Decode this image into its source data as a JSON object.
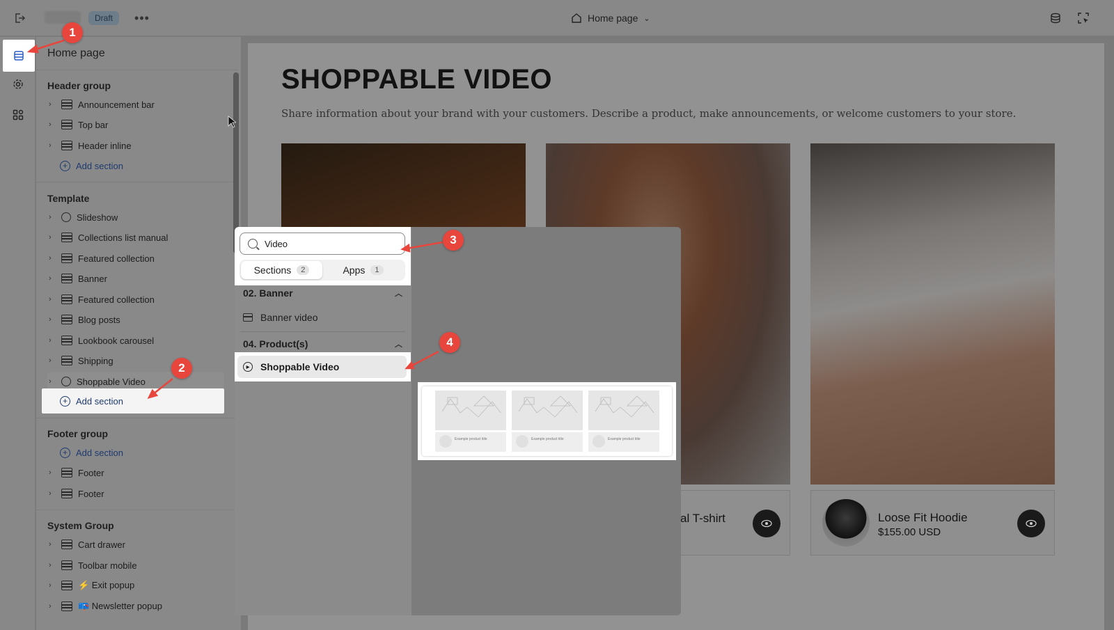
{
  "topbar": {
    "status_badge": "Draft",
    "page_selector": "Home page"
  },
  "sidebar": {
    "title": "Home page",
    "header_group": {
      "label": "Header group",
      "items": [
        "Announcement bar",
        "Top bar",
        "Header inline"
      ],
      "add_label": "Add section"
    },
    "template": {
      "label": "Template",
      "items": [
        "Slideshow",
        "Collections list manual",
        "Featured collection",
        "Banner",
        "Featured collection",
        "Blog posts",
        "Lookbook carousel",
        "Shipping",
        "Shoppable Video"
      ],
      "add_label": "Add section"
    },
    "footer_group": {
      "label": "Footer group",
      "add_label": "Add section",
      "items": [
        "Footer",
        "Footer"
      ]
    },
    "system_group": {
      "label": "System Group",
      "items": [
        "Cart drawer",
        "Toolbar mobile",
        "⚡ Exit popup",
        "📪 Newsletter popup"
      ]
    }
  },
  "picker": {
    "search_value": "Video",
    "tabs": [
      {
        "label": "Sections",
        "count": "2"
      },
      {
        "label": "Apps",
        "count": "1"
      }
    ],
    "categories": [
      {
        "label": "02. Banner",
        "results": [
          "Banner video"
        ]
      },
      {
        "label": "04. Product(s)",
        "results": [
          "Shoppable Video"
        ]
      }
    ],
    "preview_caption": "Example product title"
  },
  "preview": {
    "title": "SHOPPABLE VIDEO",
    "description": "Share information about your brand with your customers. Describe a product, make announcements, or welcome customers to your store.",
    "cards": [
      {
        "name": "al T-shirt"
      },
      {
        "name": "Loose Fit Hoodie",
        "price": "$155.00 USD"
      }
    ]
  },
  "annotations": [
    "1",
    "2",
    "3",
    "4"
  ],
  "colors": {
    "annotation": "#e8453c",
    "link": "#1e3a6e"
  }
}
